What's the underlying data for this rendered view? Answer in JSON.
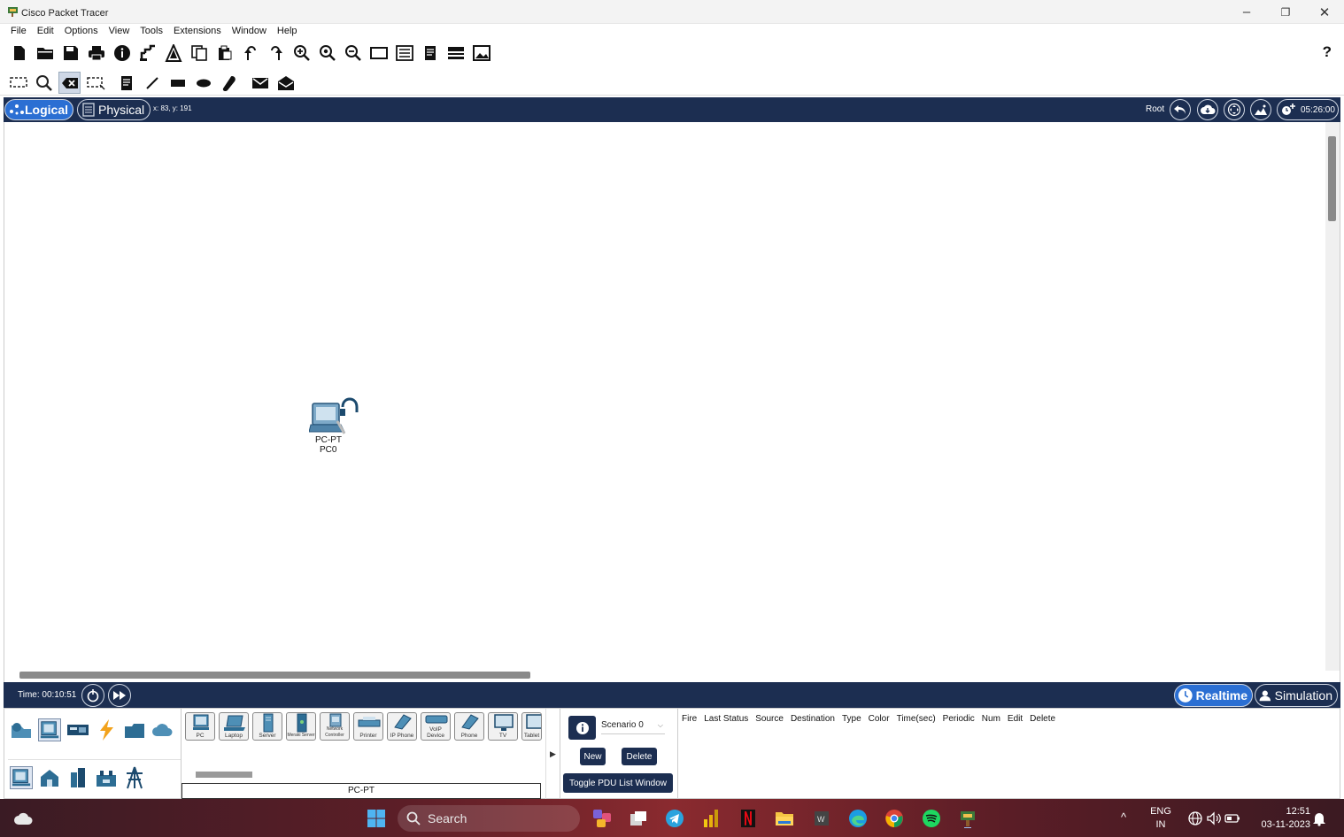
{
  "window": {
    "title": "Cisco Packet Tracer",
    "minimize": "–",
    "maximize": "❐",
    "close": "✕"
  },
  "menu": [
    "File",
    "Edit",
    "Options",
    "View",
    "Tools",
    "Extensions",
    "Window",
    "Help"
  ],
  "toolbar": {
    "help_label": "?"
  },
  "modebar": {
    "logical_label": "Logical",
    "physical_label": "Physical",
    "coords": "x: 83, y: 191",
    "root_label": "Root",
    "clock": "05:26:00"
  },
  "workspace": {
    "device": {
      "model": "PC-PT",
      "name": "PC0"
    }
  },
  "timebar": {
    "time": "Time: 00:10:51",
    "realtime_label": "Realtime",
    "simulation_label": "Simulation"
  },
  "devices": {
    "tiles": [
      "PC",
      "Laptop",
      "Server",
      "Meraki Server",
      "Network Controller",
      "Printer",
      "IP Phone",
      "VoIP Device",
      "Phone",
      "TV",
      "Tablet"
    ],
    "selected_name": "PC-PT"
  },
  "scenario": {
    "selected": "Scenario 0",
    "new_label": "New",
    "delete_label": "Delete",
    "toggle_label": "Toggle PDU List Window"
  },
  "pdu_headers": [
    "Fire",
    "Last Status",
    "Source",
    "Destination",
    "Type",
    "Color",
    "Time(sec)",
    "Periodic",
    "Num",
    "Edit",
    "Delete"
  ],
  "taskbar": {
    "search_placeholder": "Search",
    "lang_line1": "ENG",
    "lang_line2": "IN",
    "time": "12:51",
    "date": "03-11-2023"
  },
  "colors": {
    "navy": "#1c2e51",
    "accent_blue": "#2b6fd3"
  }
}
